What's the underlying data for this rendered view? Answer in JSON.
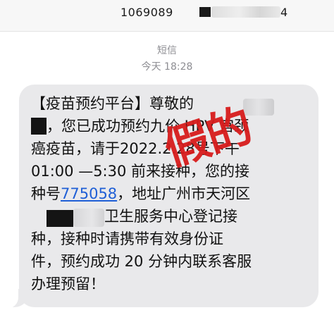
{
  "header": {
    "sender_prefix": "1069089",
    "sender_suffix": "4"
  },
  "meta": {
    "type_label": "短信",
    "time_label": "今天 18:28"
  },
  "message": {
    "lines": [
      "【疫苗预约平台】尊敬的",
      "，您已成功预约九价 HPV 宫颈",
      "癌疫苗，请于2022.2.28号下午",
      "01:00 —5:30 前来接种，您的接",
      "种号",
      "，地址广州市天河区",
      "卫生服务中心登记接",
      "种，接种时请携带有效身份证",
      "件，预约成功 20 分钟内联系客服",
      "办理预留！"
    ],
    "code_link": "775058"
  },
  "overlay": {
    "stamp_text": "假的"
  }
}
